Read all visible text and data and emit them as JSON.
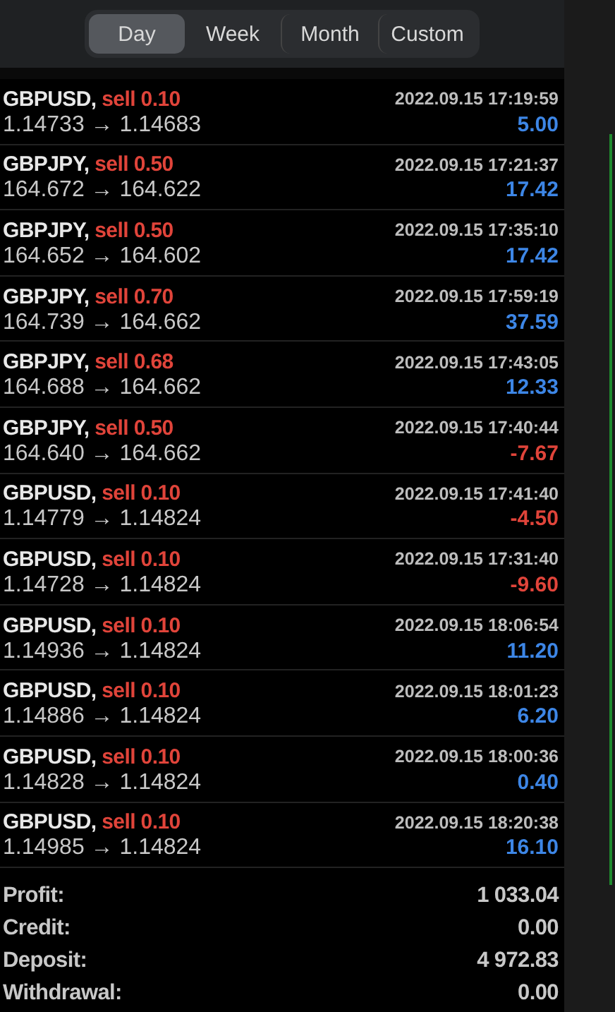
{
  "period_tabs": [
    {
      "label": "Day",
      "selected": true
    },
    {
      "label": "Week",
      "selected": false
    },
    {
      "label": "Month",
      "selected": false
    },
    {
      "label": "Custom",
      "selected": false
    }
  ],
  "deals": [
    {
      "symbol": "GBPUSD,",
      "action": "sell 0.10",
      "time": "2022.09.15 17:19:59",
      "prices": "1.14733 → 1.14683",
      "profit": "5.00",
      "positive": true
    },
    {
      "symbol": "GBPJPY,",
      "action": "sell 0.50",
      "time": "2022.09.15 17:21:37",
      "prices": "164.672 → 164.622",
      "profit": "17.42",
      "positive": true
    },
    {
      "symbol": "GBPJPY,",
      "action": "sell 0.50",
      "time": "2022.09.15 17:35:10",
      "prices": "164.652 → 164.602",
      "profit": "17.42",
      "positive": true
    },
    {
      "symbol": "GBPJPY,",
      "action": "sell 0.70",
      "time": "2022.09.15 17:59:19",
      "prices": "164.739 → 164.662",
      "profit": "37.59",
      "positive": true
    },
    {
      "symbol": "GBPJPY,",
      "action": "sell 0.68",
      "time": "2022.09.15 17:43:05",
      "prices": "164.688 → 164.662",
      "profit": "12.33",
      "positive": true
    },
    {
      "symbol": "GBPJPY,",
      "action": "sell 0.50",
      "time": "2022.09.15 17:40:44",
      "prices": "164.640 → 164.662",
      "profit": "-7.67",
      "positive": false
    },
    {
      "symbol": "GBPUSD,",
      "action": "sell 0.10",
      "time": "2022.09.15 17:41:40",
      "prices": "1.14779 → 1.14824",
      "profit": "-4.50",
      "positive": false
    },
    {
      "symbol": "GBPUSD,",
      "action": "sell 0.10",
      "time": "2022.09.15 17:31:40",
      "prices": "1.14728 → 1.14824",
      "profit": "-9.60",
      "positive": false
    },
    {
      "symbol": "GBPUSD,",
      "action": "sell 0.10",
      "time": "2022.09.15 18:06:54",
      "prices": "1.14936 → 1.14824",
      "profit": "11.20",
      "positive": true
    },
    {
      "symbol": "GBPUSD,",
      "action": "sell 0.10",
      "time": "2022.09.15 18:01:23",
      "prices": "1.14886 → 1.14824",
      "profit": "6.20",
      "positive": true
    },
    {
      "symbol": "GBPUSD,",
      "action": "sell 0.10",
      "time": "2022.09.15 18:00:36",
      "prices": "1.14828 → 1.14824",
      "profit": "0.40",
      "positive": true
    },
    {
      "symbol": "GBPUSD,",
      "action": "sell 0.10",
      "time": "2022.09.15 18:20:38",
      "prices": "1.14985 → 1.14824",
      "profit": "16.10",
      "positive": true
    }
  ],
  "summary": [
    {
      "label": "Profit:",
      "value": "1 033.04"
    },
    {
      "label": "Credit:",
      "value": "0.00"
    },
    {
      "label": "Deposit:",
      "value": "4 972.83"
    },
    {
      "label": "Withdrawal:",
      "value": "0.00"
    }
  ]
}
